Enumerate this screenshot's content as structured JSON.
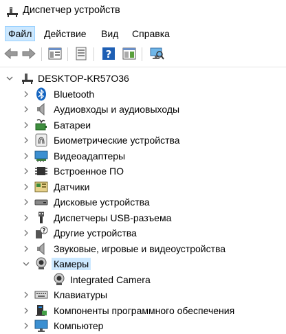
{
  "window": {
    "title": "Диспетчер устройств"
  },
  "menu": [
    {
      "label": "Файл",
      "active": true
    },
    {
      "label": "Действие",
      "active": false
    },
    {
      "label": "Вид",
      "active": false
    },
    {
      "label": "Справка",
      "active": false
    }
  ],
  "toolbar": {
    "buttons": [
      "back-icon",
      "forward-icon",
      "properties-panel-icon",
      "document-icon",
      "help-icon",
      "view-panel-icon",
      "scan-monitor-icon"
    ]
  },
  "tree": {
    "root": "DESKTOP-KR57O36",
    "items": [
      {
        "label": "Bluetooth",
        "icon": "bluetooth-icon"
      },
      {
        "label": "Аудиовходы и аудиовыходы",
        "icon": "speaker-icon"
      },
      {
        "label": "Батареи",
        "icon": "battery-icon"
      },
      {
        "label": "Биометрические устройства",
        "icon": "fingerprint-icon"
      },
      {
        "label": "Видеоадаптеры",
        "icon": "display-adapter-icon"
      },
      {
        "label": "Встроенное ПО",
        "icon": "firmware-chip-icon"
      },
      {
        "label": "Датчики",
        "icon": "sensor-icon"
      },
      {
        "label": "Дисковые устройства",
        "icon": "disk-drive-icon"
      },
      {
        "label": "Диспетчеры USB-разъема",
        "icon": "usb-connector-icon"
      },
      {
        "label": "Другие устройства",
        "icon": "unknown-device-icon"
      },
      {
        "label": "Звуковые, игровые и видеоустройства",
        "icon": "sound-speaker-icon"
      },
      {
        "label": "Камеры",
        "icon": "webcam-icon",
        "expanded": true,
        "selected": true
      },
      {
        "label": "Integrated Camera",
        "icon": "webcam-icon",
        "child": true
      },
      {
        "label": "Клавиатуры",
        "icon": "keyboard-icon"
      },
      {
        "label": "Компоненты программного обеспечения",
        "icon": "software-component-icon"
      },
      {
        "label": "Компьютер",
        "icon": "computer-icon"
      }
    ]
  },
  "colors": {
    "selection": "#cce8ff",
    "selection_border": "#99d1ff",
    "bluetooth": "#1565c0"
  }
}
